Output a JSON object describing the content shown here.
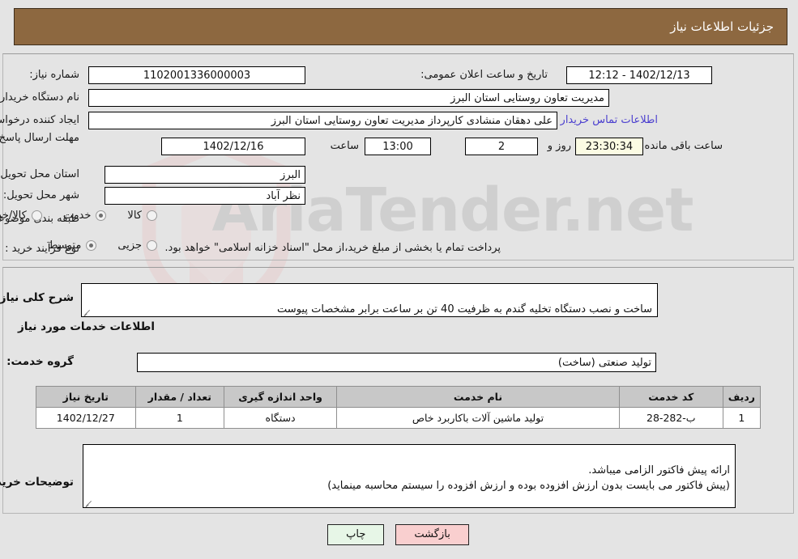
{
  "header": {
    "title": "جزئیات اطلاعات نیاز"
  },
  "watermark": {
    "text": "AriaTender.net"
  },
  "form": {
    "labels": {
      "need_number": "شماره نیاز:",
      "buyer_org": "نام دستگاه خریدار:",
      "requester": "ایجاد کننده درخواست:",
      "deadline": "مهلت ارسال پاسخ: تا تاریخ:",
      "province": "استان محل تحویل:",
      "city": "شهر محل تحویل:",
      "category": "طبقه بندی موضوعی:",
      "process_type": "نوع فرآیند خرید :",
      "public_announce": "تاریخ و ساعت اعلان عمومی:",
      "hour": "ساعت",
      "day_and": "روز و",
      "remaining": "ساعت باقی مانده",
      "contact_link": "اطلاعات تماس خریدار"
    },
    "values": {
      "need_number": "1102001336000003",
      "buyer_org": "مدیریت تعاون روستایی استان البرز",
      "requester": "علی دهقان منشادی کارپرداز مدیریت تعاون روستایی استان البرز",
      "deadline_date": "1402/12/16",
      "deadline_hour": "13:00",
      "remaining_days": "2",
      "remaining_time": "23:30:34",
      "province": "البرز",
      "city": "نظر آباد",
      "public_announce": "1402/12/13 - 12:12"
    },
    "category_options": [
      {
        "label": "کالا",
        "selected": false
      },
      {
        "label": "خدمت",
        "selected": true
      },
      {
        "label": "کالا/خدمت",
        "selected": false
      }
    ],
    "process_options": [
      {
        "label": "جزیی",
        "selected": false
      },
      {
        "label": "متوسط",
        "selected": true
      }
    ],
    "process_note": "پرداخت تمام یا بخشی از مبلغ خرید،از محل \"اسناد خزانه اسلامی\" خواهد بود."
  },
  "description": {
    "label": "شرح کلی نیاز:",
    "value": "ساخت و نصب دستگاه تخلیه گندم به ظرفیت 40 تن بر ساعت برابر مشخصات پیوست"
  },
  "services_section": {
    "heading": "اطلاعات خدمات مورد نیاز",
    "group_label": "گروه خدمت:",
    "group_value": "تولید صنعتی (ساخت)"
  },
  "table": {
    "columns": [
      "ردیف",
      "کد خدمت",
      "نام خدمت",
      "واحد اندازه گیری",
      "تعداد / مقدار",
      "تاریخ نیاز"
    ],
    "rows": [
      {
        "row": "1",
        "code": "ب-282-28",
        "name": "تولید ماشین آلات باکاربرد خاص",
        "unit": "دستگاه",
        "qty": "1",
        "date": "1402/12/27"
      }
    ]
  },
  "buyer_notes": {
    "label": "توضیحات خریدار:",
    "value": "ارائه پیش فاکتور الزامی میباشد.\n(پیش فاکتور می بایست بدون ارزش افزوده بوده و  ارزش افزوده را سیستم محاسبه مینماید)"
  },
  "buttons": {
    "print": "چاپ",
    "back": "بازگشت"
  },
  "colors": {
    "header_bg": "#8d6840",
    "page_bg": "#e4e4e4",
    "link": "#4b3fcf",
    "table_header_bg": "#c8c8c8",
    "btn_print_bg": "#e7f6e7",
    "btn_back_bg": "#f9cfcf",
    "countdown_bg": "#fbfbe3"
  }
}
